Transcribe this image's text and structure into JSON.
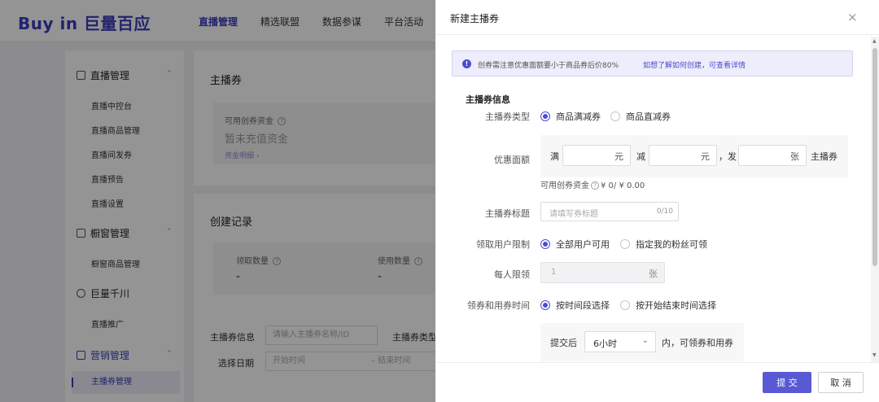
{
  "app": {
    "logo": "Buy in 巨量百应"
  },
  "topnav": [
    "直播管理",
    "精选联盟",
    "数据参谋",
    "平台活动"
  ],
  "sidebar": {
    "groups": [
      {
        "label": "直播管理",
        "items": [
          "直播中控台",
          "直播商品管理",
          "直播间发券",
          "直播预告",
          "直播设置"
        ]
      },
      {
        "label": "橱窗管理",
        "items": [
          "橱窗商品管理"
        ]
      },
      {
        "label": "巨量千川",
        "items": [
          "直播推广"
        ]
      },
      {
        "label": "营销管理",
        "items": [
          "主播券管理"
        ]
      }
    ]
  },
  "main": {
    "title": "主播券",
    "fund_label": "可用创券资金",
    "fund_value": "暂未充值资金",
    "fund_link": "资金明细 ›",
    "record_title": "创建记录",
    "stats": [
      {
        "label": "领取数量",
        "value": "-"
      },
      {
        "label": "使用数量",
        "value": "-"
      }
    ],
    "filter_name_label": "主播券信息",
    "filter_name_placeholder": "请输入主播券名称/ID",
    "filter_type_label": "主播券类型",
    "filter_date_label": "选择日期",
    "filter_start_placeholder": "开始时间",
    "filter_sep": "–",
    "filter_end_placeholder": "结束时间"
  },
  "modal": {
    "title": "新建主播券",
    "close": "×",
    "notice_icon": "!",
    "notice_text": "创券需注意优惠面额要小于商品券后价80%",
    "notice_link": "如想了解如何创建，可查看详情",
    "section_title": "主播券信息",
    "type_label": "主播券类型",
    "type_options": [
      "商品满减券",
      "商品直减券"
    ],
    "amount_label": "优惠面额",
    "amount_full": "满",
    "amount_yuan": "元",
    "amount_minus": "减",
    "amount_issue": "，发",
    "amount_zhang": "张",
    "amount_suffix": "主播券",
    "fund_note_prefix": "可用创券资金",
    "fund_note_value": "¥ 0/ ¥ 0.00",
    "coupon_title_label": "主播券标题",
    "coupon_title_placeholder": "请填写券标题",
    "coupon_title_count": "0/10",
    "user_limit_label": "领取用户限制",
    "user_limit_options": [
      "全部用户可用",
      "指定我的粉丝可领"
    ],
    "per_person_label": "每人限领",
    "per_person_value": "1",
    "per_person_unit": "张",
    "time_label": "领券和用券时间",
    "time_options": [
      "按时间段选择",
      "按开始结束时间选择"
    ],
    "time_after": "提交后",
    "time_select": "6小时",
    "time_within": "内，可领券和用券",
    "submit": "提 交",
    "cancel": "取 消"
  },
  "colors": {
    "accent": "#4b4bcf",
    "brand": "#3c3cbd"
  }
}
